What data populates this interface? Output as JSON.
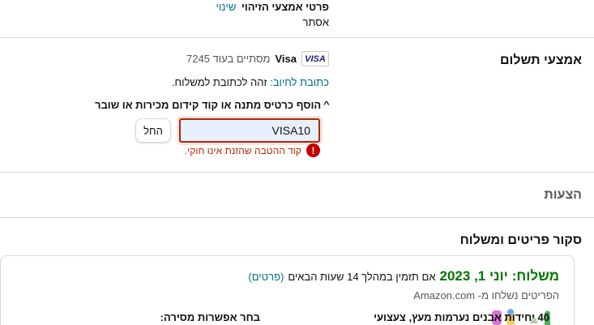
{
  "identity": {
    "title": "פרטי אמצעי הזיהוי",
    "change_label": "שינוי",
    "value": "אסתר"
  },
  "payment": {
    "section_title": "אמצעי תשלום",
    "card_brand_logo": "VISA",
    "card_brand": "Visa",
    "card_ending_text": "מסתיים בעוד 7245",
    "billing_label": "כתובת לחיוב:",
    "billing_value": "זהה לכתובת למשלוח.",
    "gift_toggle_label": "הוסף כרטיס מתנה או קוד קידום מכירות או שובר",
    "promo_input_value": "VISA10",
    "apply_label": "החל",
    "error_message": "קוד ההטבה שהזנת אינו חוקי."
  },
  "offers": {
    "section_title": "הצעות"
  },
  "review": {
    "section_title": "סקור פריטים ומשלוח",
    "delivery_prefix": "משלוח:",
    "delivery_date": "יוני 1, 2023",
    "order_within": "אם תזמין במהלך 14 שעות הבאים",
    "details_link": "(פרטים)",
    "shipped_from": "הפריטים נשלחו מ- Amazon.com",
    "product_title": "40 יחידות אבנים נערמות מעץ, צעצועי",
    "delivery_options_label": "בחר אפשרות מסירה:"
  },
  "colors": {
    "link": "#007185",
    "error": "#b12704",
    "delivery_green": "#007600"
  }
}
